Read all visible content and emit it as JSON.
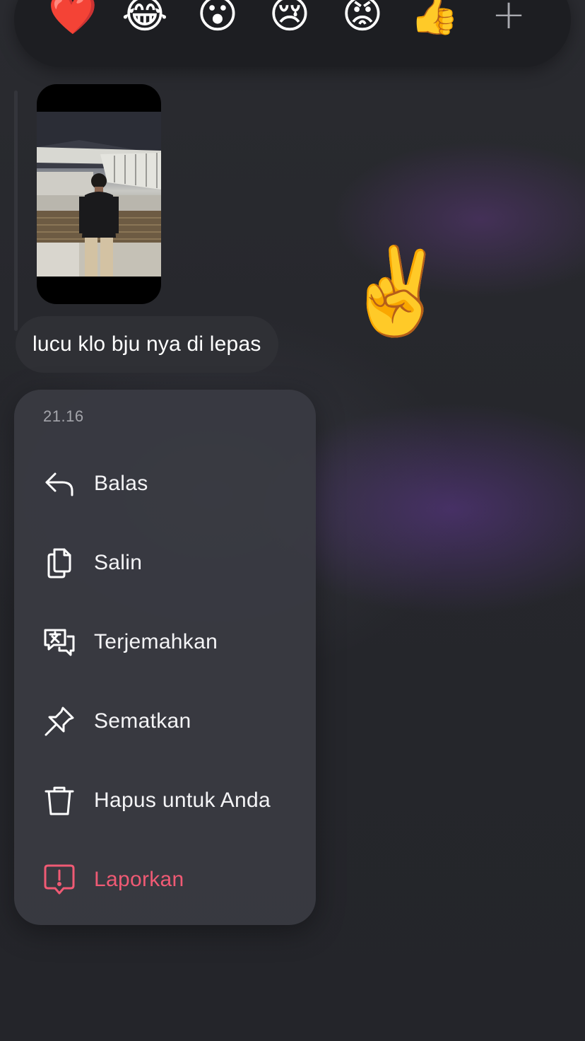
{
  "reactions": {
    "items": [
      {
        "emoji": "❤️",
        "name": "heart"
      },
      {
        "emoji": "😂",
        "name": "laugh"
      },
      {
        "emoji": "😮",
        "name": "wow"
      },
      {
        "emoji": "😢",
        "name": "sad"
      },
      {
        "emoji": "😡",
        "name": "angry"
      },
      {
        "emoji": "👍",
        "name": "thumbs-up"
      }
    ],
    "more": "+"
  },
  "message": {
    "text": "lucu klo bju nya di lepas"
  },
  "sticker": {
    "emoji": "✌️"
  },
  "menu": {
    "time": "21.16",
    "items": [
      {
        "label": "Balas",
        "icon": "reply-icon"
      },
      {
        "label": "Salin",
        "icon": "copy-icon"
      },
      {
        "label": "Terjemahkan",
        "icon": "translate-icon"
      },
      {
        "label": "Sematkan",
        "icon": "pin-icon"
      },
      {
        "label": "Hapus untuk Anda",
        "icon": "trash-icon"
      },
      {
        "label": "Laporkan",
        "icon": "report-icon",
        "color": "#f05a74"
      }
    ]
  }
}
